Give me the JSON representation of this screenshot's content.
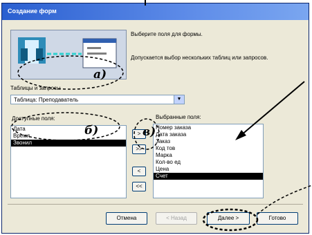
{
  "window": {
    "title": "Создание форм"
  },
  "header": {
    "prompt": "Выберите поля для формы.",
    "hint": "Допускается выбор нескольких таблиц или запросов."
  },
  "source": {
    "label": "Таблицы и запросы",
    "selected": "Таблица: Преподаватель"
  },
  "available": {
    "label": "Доступные поля:",
    "items": [
      {
        "text": "Дата"
      },
      {
        "text": "Время"
      },
      {
        "text": "Звонил"
      }
    ]
  },
  "selected_fields": {
    "label": "Выбранные поля:",
    "items": [
      {
        "text": "Номер заказа"
      },
      {
        "text": "Дата заказа"
      },
      {
        "text": "Заказ"
      },
      {
        "text": "Код тов"
      },
      {
        "text": "Марка"
      },
      {
        "text": "Кол-во ед"
      },
      {
        "text": "Цена"
      },
      {
        "text": "Счет"
      }
    ]
  },
  "move_buttons": {
    "add": ">",
    "add_all": ">>",
    "remove": "<",
    "remove_all": "<<"
  },
  "footer": {
    "cancel": "Отмена",
    "back": "< Назад",
    "next": "Далее >",
    "finish": "Готово"
  },
  "annotations": {
    "a": "а)",
    "b": "б)",
    "c": "в)"
  }
}
